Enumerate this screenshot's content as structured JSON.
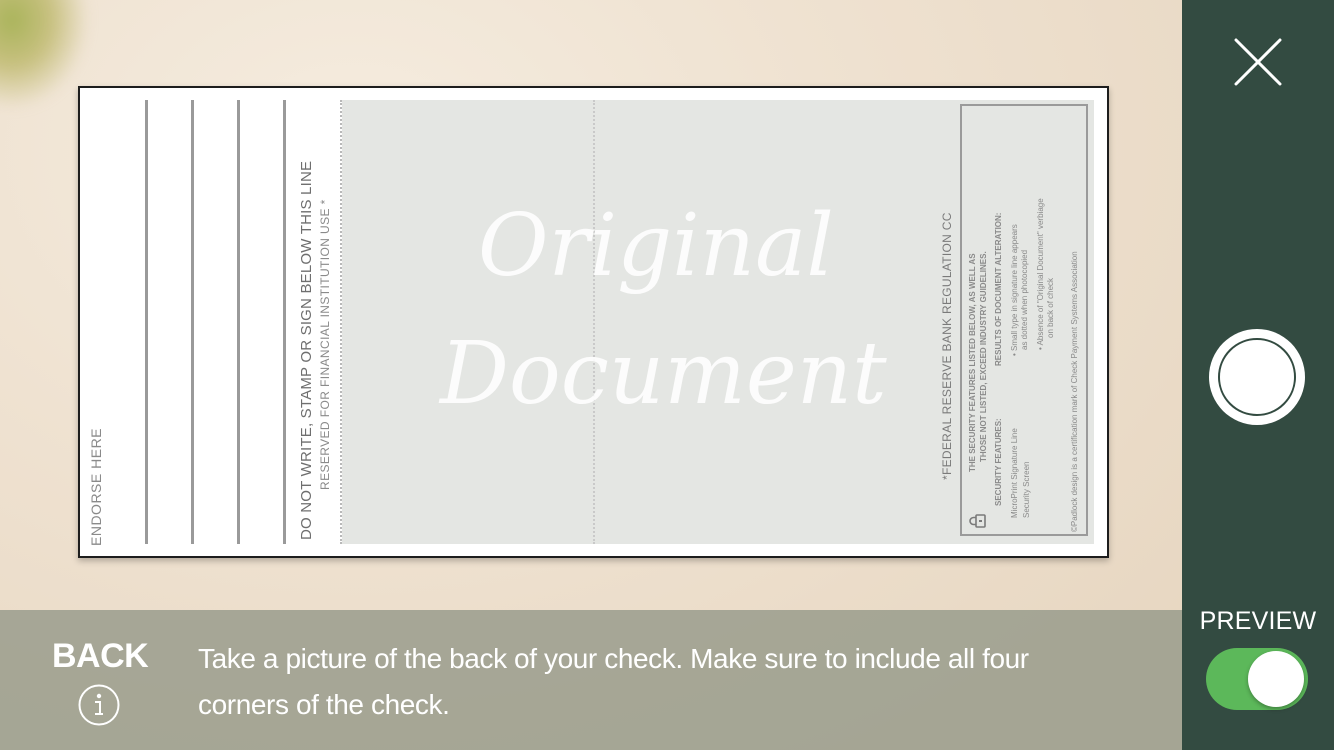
{
  "camera": {
    "check": {
      "endorse_label": "ENDORSE HERE",
      "do_not_write": "DO NOT WRITE, STAMP OR SIGN BELOW THIS LINE",
      "reserved": "RESERVED FOR FINANCIAL INSTITUTION USE *",
      "watermark_line1": "Original",
      "watermark_line2": "Document",
      "fed_reg": "*FEDERAL RESERVE BANK REGULATION CC",
      "security_box": {
        "header1": "THE SECURITY FEATURES LISTED BELOW, AS WELL AS",
        "header2": "THOSE NOT LISTED, EXCEED INDUSTRY GUIDELINES.",
        "features_title": "SECURITY FEATURES:",
        "feature1": "MicroPrint Signature Line",
        "feature2": "Security Screen",
        "results_title": "RESULTS OF DOCUMENT ALTERATION:",
        "result1": "• Small type in signature line appears",
        "result1b": "as dotted when photocopied",
        "result2": "• Absence of \"Original Document\" verbiage",
        "result2b": "on back of check",
        "footer": "©Padlock design is a certification mark of Check Payment Systems Association"
      }
    }
  },
  "instruction_bar": {
    "side_label": "BACK",
    "info_icon": "info-icon",
    "text": "Take a picture of the back of your check. Make sure to include all four corners of the check."
  },
  "controls": {
    "close_icon": "close-icon",
    "shutter": "shutter-button",
    "preview_label": "PREVIEW",
    "preview_toggle_on": true,
    "colors": {
      "panel": "#334b41",
      "toggle_on": "#5cb85a"
    }
  }
}
